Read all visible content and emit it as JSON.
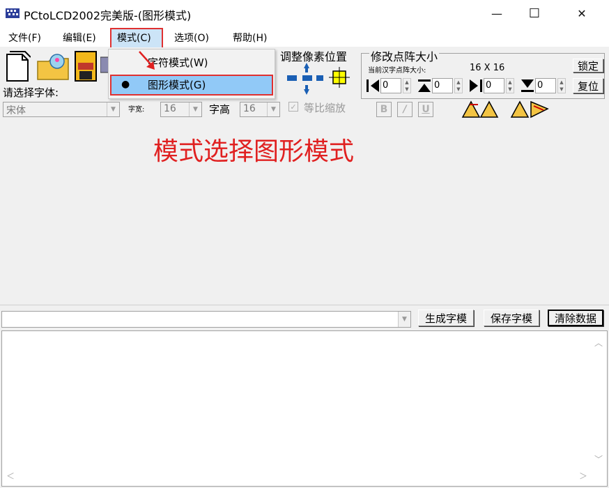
{
  "window": {
    "title": "PCtoLCD2002完美版-(图形模式)",
    "minimize": "—",
    "maximize": "☐",
    "close": "✕"
  },
  "menu": {
    "items": [
      "文件(F)",
      "编辑(E)",
      "模式(C)",
      "选项(O)",
      "帮助(H)"
    ]
  },
  "mode_menu": {
    "char_mode": "字符模式(W)",
    "graphic_mode": "图形模式(G)",
    "bullet": "●"
  },
  "font_panel": {
    "select_font_label": "请选择字体:",
    "font_value": "宋体",
    "char_width_label": "字宽:",
    "char_width_value": "16",
    "char_height_label": "字高",
    "char_height_value": "16",
    "proportional_label": "等比缩放",
    "bold": "B",
    "italic": "/",
    "underline": "U"
  },
  "pixel_adjust": {
    "label": "调整像素位置"
  },
  "dot_matrix": {
    "label": "修改点阵大小",
    "current_label": "当前汉字点阵大小:",
    "current_value": "16 X 16",
    "lock_button": "锁定",
    "reset_button": "复位",
    "spin_values": [
      "0",
      "0",
      "0",
      "0"
    ]
  },
  "annotation": {
    "text": "模式选择图形模式"
  },
  "output": {
    "generate_button": "生成字模",
    "save_button": "保存字模",
    "clear_button": "清除数据"
  },
  "colors": {
    "highlight_red": "#e03030",
    "selection_blue": "#91c9f7",
    "annotation_red": "#e02020"
  }
}
